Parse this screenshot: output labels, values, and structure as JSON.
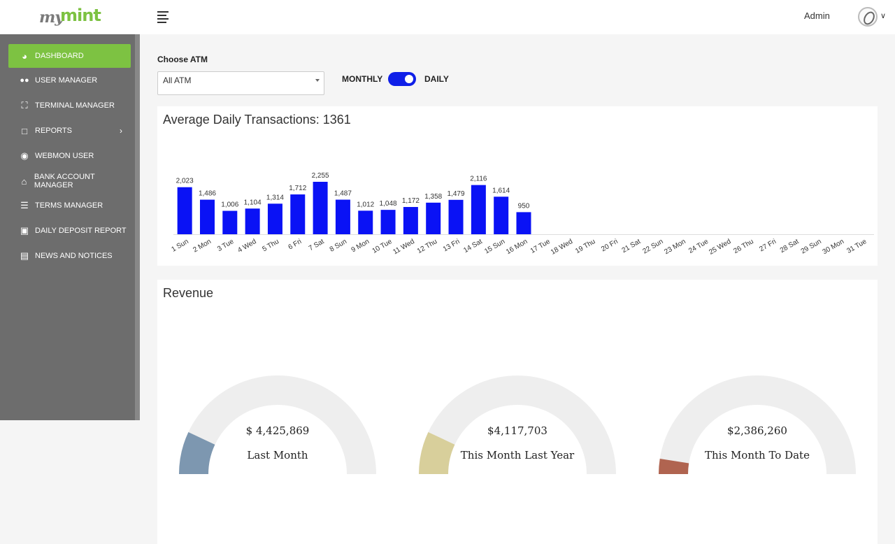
{
  "header": {
    "logo_text_my": "my",
    "logo_text_mint": "mint",
    "user_name": "Admin",
    "menu_icon": "hamburger-icon",
    "avatar_icon": "user-avatar-icon",
    "dropdown_icon": "chevron-down-icon"
  },
  "sidebar": {
    "active_color": "#7dc242",
    "items": [
      {
        "label": "DASHBOARD",
        "icon": "dashboard-icon",
        "glyph": "◕"
      },
      {
        "label": "USER MANAGER",
        "icon": "users-icon",
        "glyph": "👥"
      },
      {
        "label": "TERMINAL MANAGER",
        "icon": "terminal-icon",
        "glyph": "⛶"
      },
      {
        "label": "REPORTS",
        "icon": "file-icon",
        "glyph": "🗋"
      },
      {
        "label": "WEBMON USER",
        "icon": "user-circle-icon",
        "glyph": "◉"
      },
      {
        "label": "BANK ACCOUNT MANAGER",
        "icon": "bank-icon",
        "glyph": "🏛"
      },
      {
        "label": "TERMS MANAGER",
        "icon": "list-icon",
        "glyph": "☰"
      },
      {
        "label": "DAILY DEPOSIT REPORT",
        "icon": "money-icon",
        "glyph": "💵"
      },
      {
        "label": "NEWS AND NOTICES",
        "icon": "newspaper-icon",
        "glyph": "📰"
      }
    ],
    "reports_caret": "›"
  },
  "filters": {
    "choose_atm_label": "Choose ATM",
    "atm_selected": "All ATM",
    "monthly_label": "MONTHLY",
    "daily_label": "DAILY"
  },
  "transactions_card": {
    "title": "Average Daily Transactions: 1361"
  },
  "chart_data": {
    "type": "bar",
    "title": "Average Daily Transactions: 1361",
    "xlabel": "",
    "ylabel": "",
    "bar_color": "#0a12f5",
    "categories": [
      "1 Sun",
      "2 Mon",
      "3 Tue",
      "4 Wed",
      "5 Thu",
      "6 Fri",
      "7 Sat",
      "8 Sun",
      "9 Mon",
      "10 Tue",
      "11 Wed",
      "12 Thu",
      "13 Fri",
      "14 Sat",
      "15 Sun",
      "16 Mon",
      "17 Tue",
      "18 Wed",
      "19 Thu",
      "20 Fri",
      "21 Sat",
      "22 Sun",
      "23 Mon",
      "24 Tue",
      "25 Wed",
      "26 Thu",
      "27 Fri",
      "28 Sat",
      "29 Sun",
      "30 Mon",
      "31 Tue"
    ],
    "values": [
      2023,
      1486,
      1006,
      1104,
      1314,
      1712,
      2255,
      1487,
      1012,
      1048,
      1172,
      1358,
      1479,
      2116,
      1614,
      950,
      null,
      null,
      null,
      null,
      null,
      null,
      null,
      null,
      null,
      null,
      null,
      null,
      null,
      null,
      null
    ],
    "value_labels": [
      "2,023",
      "1,486",
      "1,006",
      "1,104",
      "1,314",
      "1,712",
      "2,255",
      "1,487",
      "1,012",
      "1,048",
      "1,172",
      "1,358",
      "1,479",
      "2,116",
      "1,614",
      "950"
    ],
    "ylim": [
      0,
      2255
    ],
    "grid": false,
    "legend": "none"
  },
  "revenue_card": {
    "title": "Revenue",
    "gauges": [
      {
        "value": "$ 4,425,869",
        "label": "Last Month",
        "color": "#7d97b0",
        "fraction": 0.14
      },
      {
        "value": "$4,117,703",
        "label": "This Month Last Year",
        "color": "#d8cf9b",
        "fraction": 0.14
      },
      {
        "value": "$2,386,260",
        "label": "This Month To Date",
        "color": "#b06450",
        "fraction": 0.05
      }
    ],
    "track_color": "#eeeeee"
  }
}
